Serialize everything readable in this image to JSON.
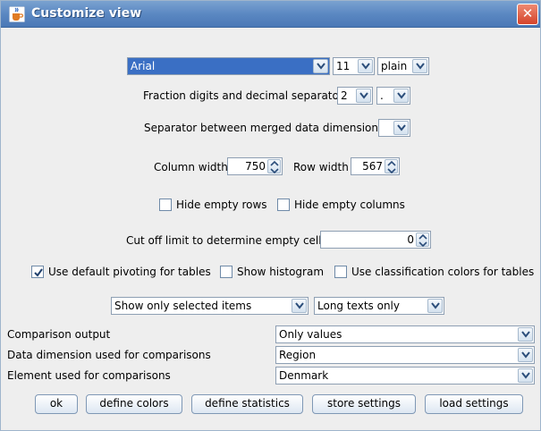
{
  "window": {
    "title": "Customize view"
  },
  "font": {
    "family": "Arial",
    "size": "11",
    "style": "plain"
  },
  "fraction": {
    "label": "Fraction digits and decimal separator",
    "digits": "2",
    "separator": "."
  },
  "merged_separator": {
    "label": "Separator between merged data dimensions",
    "value": ""
  },
  "column_width": {
    "label": "Column width",
    "value": "750"
  },
  "row_width": {
    "label": "Row width",
    "value": "567"
  },
  "hide_empty_rows": {
    "label": "Hide empty rows",
    "checked": false
  },
  "hide_empty_columns": {
    "label": "Hide empty columns",
    "checked": false
  },
  "cutoff": {
    "label": "Cut off limit to determine empty cells",
    "value": "0"
  },
  "default_pivoting": {
    "label": "Use default pivoting for tables",
    "checked": true
  },
  "show_histogram": {
    "label": "Show histogram",
    "checked": false
  },
  "classification_colors": {
    "label": "Use classification colors for tables",
    "checked": false
  },
  "selection_filter": {
    "value": "Show only selected items"
  },
  "text_filter": {
    "value": "Long texts only"
  },
  "comparison_output": {
    "label": "Comparison output",
    "value": "Only values"
  },
  "comparison_dimension": {
    "label": "Data dimension used for comparisons",
    "value": "Region"
  },
  "comparison_element": {
    "label": "Element used for comparisons",
    "value": "Denmark"
  },
  "buttons": {
    "ok": "ok",
    "define_colors": "define colors",
    "define_statistics": "define statistics",
    "store_settings": "store settings",
    "load_settings": "load settings"
  },
  "colors": {
    "titlebar": "#5b88c2",
    "selection": "#3a6fc4",
    "close": "#d4432a"
  }
}
